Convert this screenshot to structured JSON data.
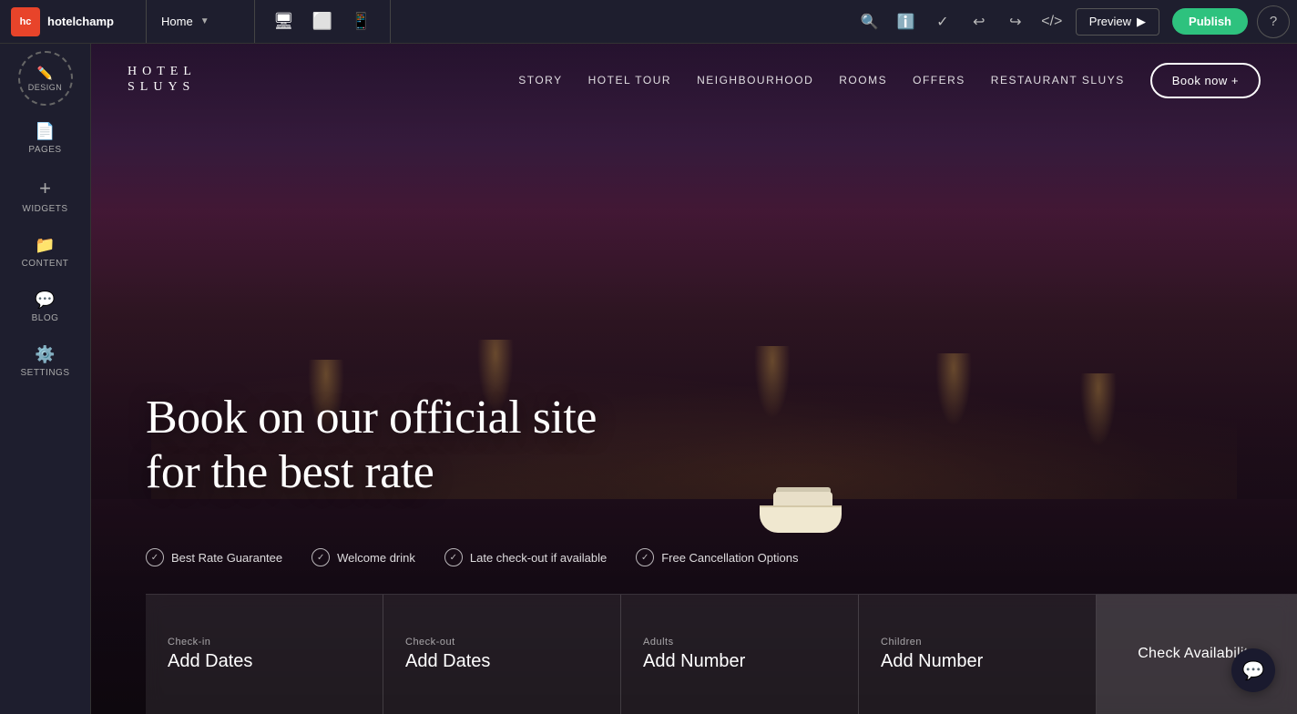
{
  "toolbar": {
    "logo_text": "hotelchamp",
    "page_selector": "Home",
    "preview_label": "Preview",
    "publish_label": "Publish",
    "help_tooltip": "Help"
  },
  "sidebar": {
    "items": [
      {
        "id": "design",
        "label": "DESIGN",
        "icon": "✏️"
      },
      {
        "id": "pages",
        "label": "PAGES",
        "icon": "📄"
      },
      {
        "id": "widgets",
        "label": "WIDGETS",
        "icon": "+"
      },
      {
        "id": "content",
        "label": "CONTENT",
        "icon": "📁"
      },
      {
        "id": "blog",
        "label": "BLOG",
        "icon": "💬"
      },
      {
        "id": "settings",
        "label": "SETTINGS",
        "icon": "⚙️"
      }
    ]
  },
  "site": {
    "logo_line1": "HOTEL",
    "logo_line2": "SLUYS",
    "nav_links": [
      "STORY",
      "HOTEL TOUR",
      "NEIGHBOURHOOD",
      "ROOMS",
      "OFFERS",
      "RESTAURANT SLUYS"
    ],
    "book_btn": "Book now +",
    "hero_heading_line1": "Book on our official site",
    "hero_heading_line2": "for the  best rate",
    "features": [
      "Best Rate Guarantee",
      "Welcome drink",
      "Late check-out if available",
      "Free Cancellation Options"
    ],
    "booking": {
      "checkin_label": "Check-in",
      "checkin_value": "Add Dates",
      "checkout_label": "Check-out",
      "checkout_value": "Add Dates",
      "adults_label": "Adults",
      "adults_value": "Add Number",
      "children_label": "Children",
      "children_value": "Add Number",
      "cta_label": "Check Availability"
    }
  }
}
